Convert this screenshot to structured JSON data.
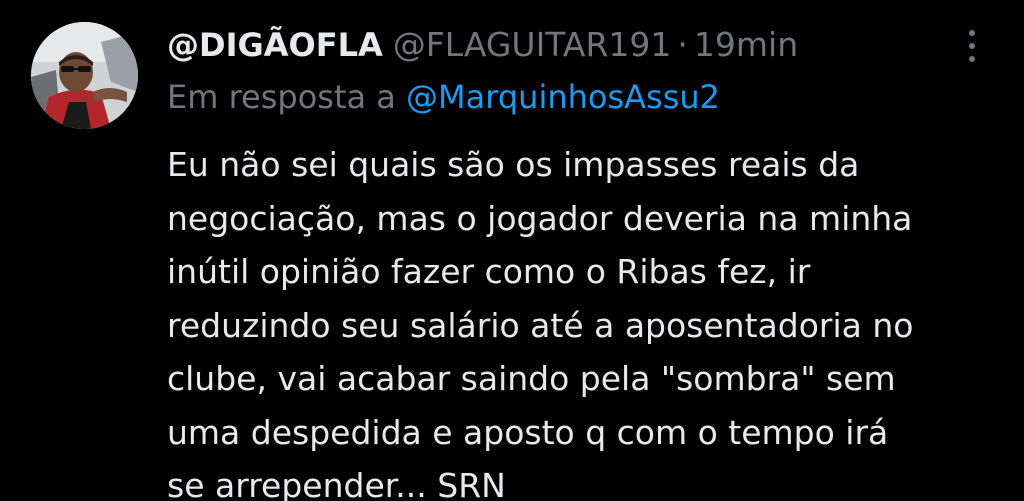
{
  "colors": {
    "background": "#000000",
    "text_primary": "#e7e9ea",
    "text_secondary": "#71767b",
    "mention": "#1d9bf0"
  },
  "tweet": {
    "display_name": "@DIGÃOFLA",
    "handle": "@FLAGUITAR191",
    "separator": "·",
    "timestamp": "19min",
    "more_icon": "more-vertical-icon",
    "reply_prefix": "Em resposta a",
    "reply_mention": "@MarquinhosAssu2",
    "text_lines": [
      "Eu não sei quais são os impasses reais da",
      "negociação, mas o jogador deveria na minha",
      "inútil opinião fazer como o Ribas fez, ir",
      "reduzindo seu salário até a aposentadoria no",
      "clube, vai acabar saindo pela \"sombra\" sem",
      "uma despedida e aposto q com o tempo irá",
      "se arrepender... SRN"
    ]
  }
}
